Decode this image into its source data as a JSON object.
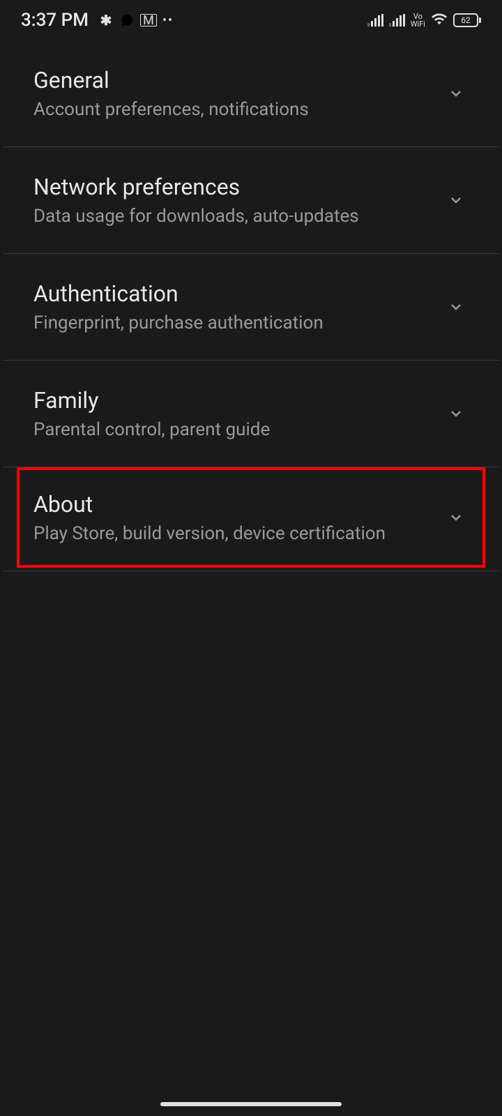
{
  "status_bar": {
    "time": "3:37 PM",
    "battery": "62",
    "vowifi_line1": "Vo",
    "vowifi_line2": "WiFi"
  },
  "settings": {
    "items": [
      {
        "title": "General",
        "subtitle": "Account preferences, notifications"
      },
      {
        "title": "Network preferences",
        "subtitle": "Data usage for downloads, auto-updates"
      },
      {
        "title": "Authentication",
        "subtitle": "Fingerprint, purchase authentication"
      },
      {
        "title": "Family",
        "subtitle": "Parental control, parent guide"
      },
      {
        "title": "About",
        "subtitle": "Play Store, build version, device certification"
      }
    ]
  }
}
